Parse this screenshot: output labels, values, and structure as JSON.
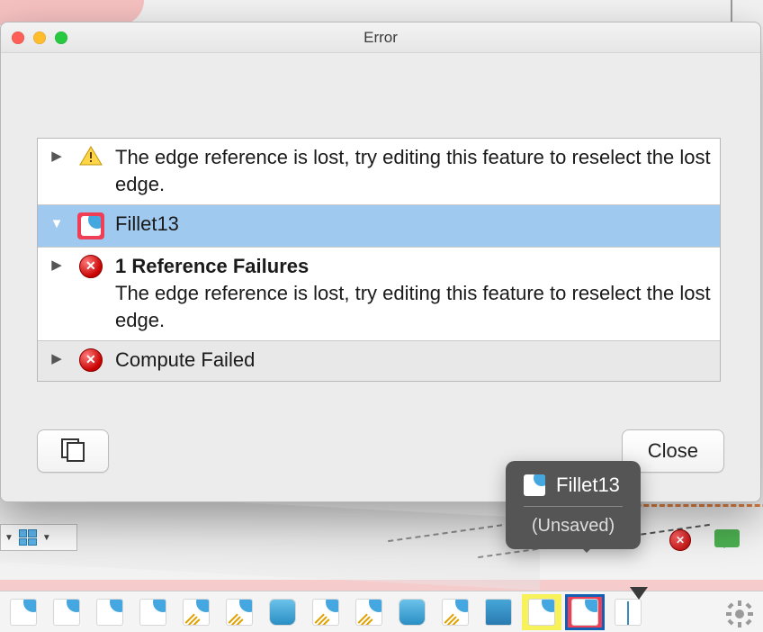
{
  "dialog": {
    "title": "Error",
    "rows": {
      "warn_msg": "The edge reference is lost, try editing this feature to reselect the lost edge.",
      "feature_name": "Fillet13",
      "fail_heading": "1 Reference Failures",
      "fail_msg": "The edge reference is lost, try editing this feature to reselect the lost edge.",
      "compute_msg": "Compute Failed"
    },
    "buttons": {
      "close": "Close"
    }
  },
  "tooltip": {
    "title": "Fillet13",
    "subtitle": "(Unsaved)"
  }
}
